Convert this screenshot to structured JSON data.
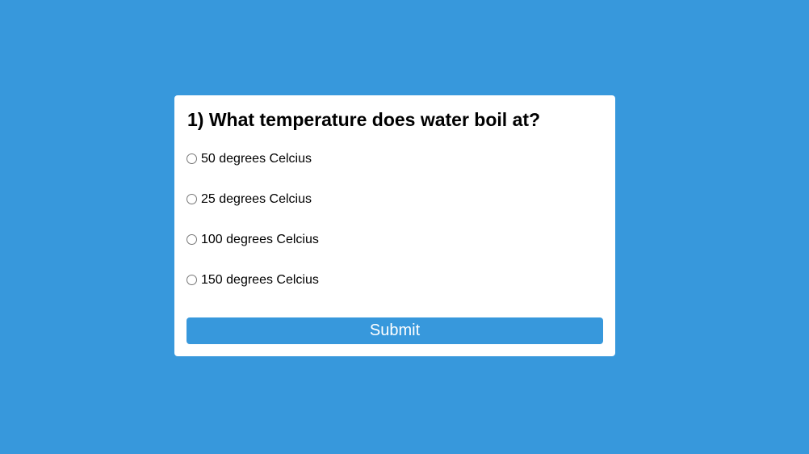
{
  "quiz": {
    "question": "1) What temperature does water boil at?",
    "options": [
      {
        "label": "50 degrees Celcius",
        "selected": false
      },
      {
        "label": "25 degrees Celcius",
        "selected": false
      },
      {
        "label": "100 degrees Celcius",
        "selected": false
      },
      {
        "label": "150 degrees Celcius",
        "selected": false
      }
    ],
    "submit_label": "Submit"
  },
  "colors": {
    "background": "#3798dc",
    "card": "#ffffff",
    "button": "#3798dc",
    "button_text": "#ffffff",
    "text": "#000000"
  },
  "icons": {
    "option_marker": "radio-circle-icon"
  }
}
